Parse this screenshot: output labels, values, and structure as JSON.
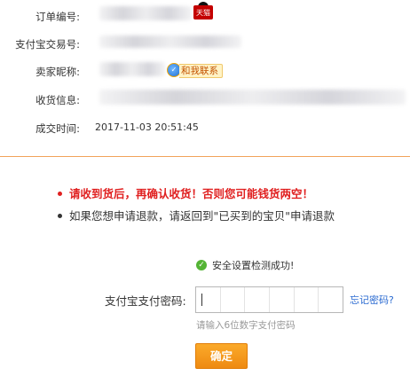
{
  "order_info": {
    "order_no_label": "订单编号:",
    "tmall_badge": "天猫",
    "alipay_trade_label": "支付宝交易号:",
    "seller_label": "卖家昵称:",
    "contact_label": "和我联系",
    "address_label": "收货信息:",
    "time_label": "成交时间:",
    "time_value": "2017-11-03 20:51:45"
  },
  "warnings": {
    "primary": "请收到货后，再确认收货！否则您可能钱货两空！",
    "secondary": "如果您想申请退款，请返回到\"已买到的宝贝\"申请退款",
    "primary_color": "#e02020",
    "secondary_color": "#333333"
  },
  "payment": {
    "security_status": "安全设置检测成功!",
    "password_label": "支付宝支付密码:",
    "forgot_link": "忘记密码?",
    "password_hint": "请输入6位数字支付密码",
    "confirm_button": "确定",
    "accent_color": "#f39a1e"
  },
  "icons": {
    "success": "check-circle-icon",
    "aliwangwang": "aliwangwang-icon",
    "tmall": "tmall-icon"
  }
}
